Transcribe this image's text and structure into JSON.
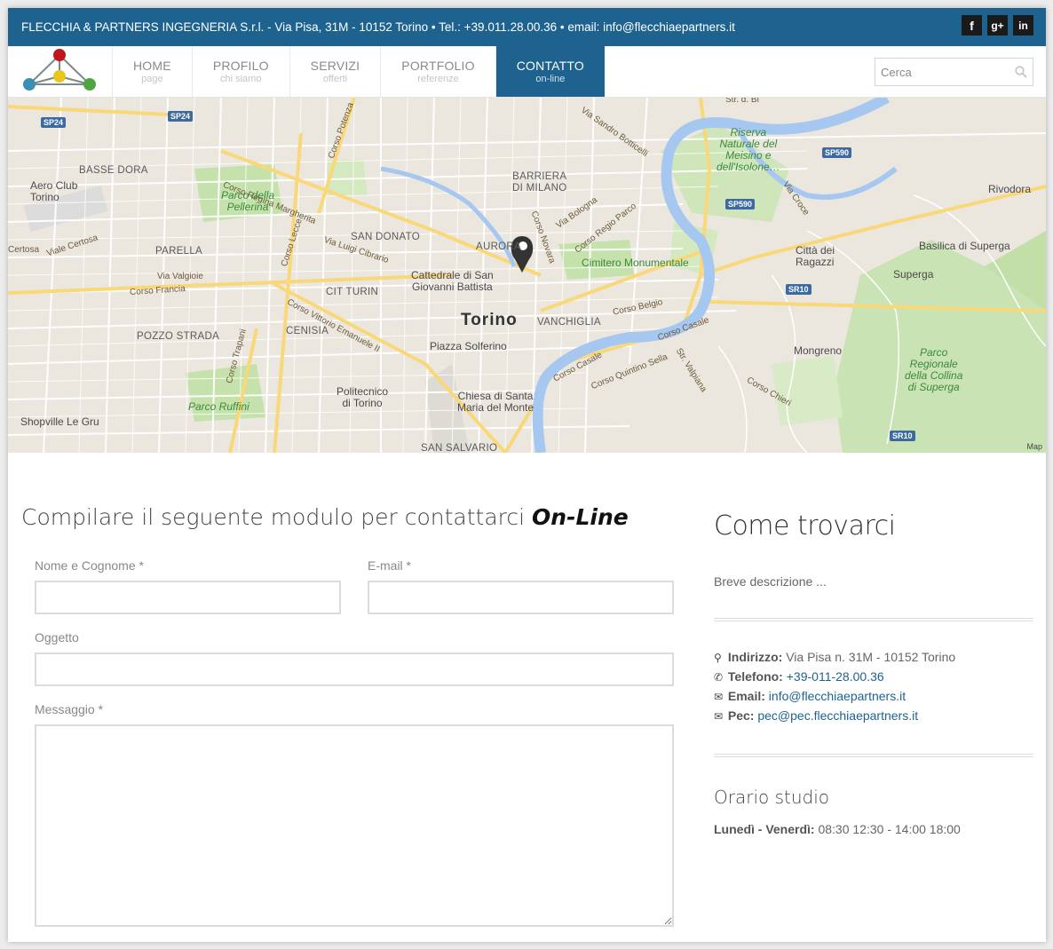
{
  "topbar": {
    "text": "FLECCHIA & PARTNERS INGEGNERIA S.r.l. - Via Pisa, 31M - 10152 Torino • Tel.: +39.011.28.00.36 • email: info@flecchiaepartners.it",
    "social": {
      "facebook": "f",
      "googleplus": "g+",
      "linkedin": "in"
    }
  },
  "nav": {
    "items": [
      {
        "label": "HOME",
        "sub": "page"
      },
      {
        "label": "PROFILO",
        "sub": "chi siamo"
      },
      {
        "label": "SERVIZI",
        "sub": "offerti"
      },
      {
        "label": "PORTFOLIO",
        "sub": "referenze"
      },
      {
        "label": "CONTATTO",
        "sub": "on-line"
      }
    ],
    "search_placeholder": "Cerca"
  },
  "map": {
    "city": "Torino",
    "credit": "Map",
    "labels": {
      "basse_dora": "BASSE DORA",
      "aeroclub": "Aero Club\nTorino",
      "parco_pellerina": "Parco della\nPellerina",
      "corso_regina": "Corso Regina Margherita",
      "corso_potenza": "Corso Potenza",
      "barriera": "BARRIERA\nDI MILANO",
      "riserva": "Riserva\nNaturale del\nMeisino e\ndell'Isolone…",
      "rivodora": "Rivodora",
      "parella": "PARELLA",
      "san_donato": "SAN DONATO",
      "aurora": "AURORA",
      "cimitero": "Cimitero Monumentale",
      "citta_ragazzi": "Città dei\nRagazzi",
      "basilica": "Basilica di Superga",
      "superga": "Superga",
      "cattedrale": "Cattedrale di San\nGiovanni Battista",
      "cit_turin": "CIT TURIN",
      "corso_francia": "Corso Francia",
      "vanchiglia": "VANCHIGLIA",
      "cenisia": "CENISIA",
      "pozzo_strada": "POZZO STRADA",
      "piazza_solferino": "Piazza Solferino",
      "mongreno": "Mongreno",
      "parco_collina": "Parco\nRegionale\ndella Collina\ndi Superga",
      "politecnico": "Politecnico\ndi Torino",
      "chiesa": "Chiesa di Santa\nMaria del Monte",
      "parco_ruffini": "Parco Ruffini",
      "shopville": "Shopville Le Gru",
      "san_salvario": "SAN SALVARIO",
      "corso_lecce": "Corso Lecce",
      "corso_casale": "Corso Casale",
      "corso_belgio": "Corso Belgio",
      "corso_vittorio": "Corso Vittorio Emanuele II",
      "corso_trapani": "Corso Trapani",
      "corso_quintino": "Corso Quintino Sella",
      "via_valgioie": "Via Valgioie",
      "viale_certosa": "Viale Certosa",
      "via_bologna": "Via Bologna",
      "corso_novara": "Corso Novara",
      "corso_regio_parco": "Corso Regio Parco",
      "via_luigi_cibrario": "Via Luigi Cibrario",
      "corso_chieri": "Corso Chieri",
      "str_valpiana": "Str. Valpiana",
      "via_sandro_botticelli": "Via Sandro Botticelli",
      "via_crose": "Via Croce",
      "certosa": "Certosa",
      "str_del_bi": "Str. d. Bi"
    },
    "shields": {
      "sp24a": "SP24",
      "sp24b": "SP24",
      "sp590a": "SP590",
      "sp590b": "SP590",
      "sr10a": "SR10",
      "sr10b": "SR10"
    }
  },
  "form": {
    "title_prefix": "Compilare il seguente modulo per contattarci",
    "title_emph": "On-Line",
    "name_label": "Nome e Cognome *",
    "email_label": "E-mail *",
    "subject_label": "Oggetto",
    "message_label": "Messaggio *"
  },
  "sidebar": {
    "title": "Come trovarci",
    "description": "Breve descrizione ...",
    "address_label": "Indirizzo:",
    "address_value": "Via Pisa n. 31M - 10152 Torino",
    "phone_label": "Telefono:",
    "phone_value": "+39-011-28.00.36",
    "email_label": "Email:",
    "email_value": "info@flecchiaepartners.it",
    "pec_label": "Pec:",
    "pec_value": "pec@pec.flecchiaepartners.it",
    "hours_title": "Orario studio",
    "hours_label": "Lunedì - Venerdì:",
    "hours_value": "08:30 12:30 - 14:00 18:00"
  }
}
